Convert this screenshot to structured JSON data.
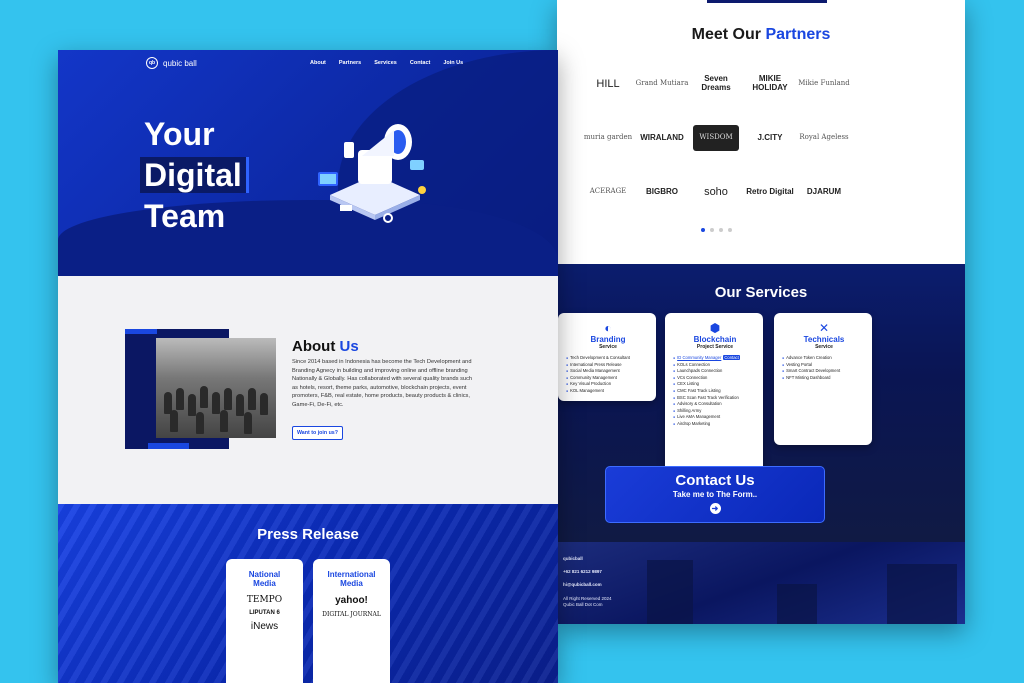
{
  "partners": {
    "title_prefix": "Meet Our",
    "title_accent": "Partners",
    "logos": [
      "HILL",
      "Grand Mutiara",
      "Seven Dreams",
      "MIKIE HOLIDAY",
      "Mikie Funland",
      "muria garden",
      "WIRALAND",
      "WISDOM",
      "J.CITY",
      "Royal Ageless",
      "ACERAGE",
      "BIGBRO",
      "soho",
      "Retro Digital",
      "DJARUM"
    ]
  },
  "services": {
    "title": "Our Services",
    "cards": [
      {
        "name": "Branding",
        "sub": "Service",
        "items": [
          "Tech Development & Consultant",
          "International Press Release",
          "Social Media Management",
          "Community Management",
          "Key Visual Production",
          "KOL Management"
        ]
      },
      {
        "name": "Blockchain",
        "sub": "Project Service",
        "items": [
          "ID Community Manager",
          "KOLs Connection",
          "Launchpads Connection",
          "VCs Connection",
          "CEX Listing",
          "CMC Fast Track Listing",
          "BSC Scan Fast Track Verification",
          "Advisory & Consultation",
          "Shilling Army",
          "Live AMA Management",
          "Airdrop Marketing"
        ],
        "tag": "Contact"
      },
      {
        "name": "Technicals",
        "sub": "Service",
        "items": [
          "Advance Token Creation",
          "Vesting Portal",
          "Smart Contract Development",
          "NFT Minting Dashboard"
        ]
      }
    ]
  },
  "contact": {
    "title": "Contact Us",
    "sub": "Take me to The Form..",
    "arrow": "➜"
  },
  "footer": {
    "name": "qubicball",
    "phone": "+62 821 6212 9897",
    "email": "hi@qubicball.com",
    "copyright1": "All Right Reserved 2024",
    "copyright2": "Qubic Ball Dot Com"
  },
  "brand": {
    "name": "qubic ball",
    "mark": "qb"
  },
  "nav": [
    "About",
    "Partners",
    "Services",
    "Contact",
    "Join Us"
  ],
  "hero": {
    "line1": "Your",
    "line2": "Digital",
    "line3": "Team"
  },
  "about": {
    "title_prefix": "About",
    "title_accent": "Us",
    "text": "Since 2014 based in Indonesia has become the Tech Development and Branding Agnecy in building and improving online and offline branding Nationally & Globally. Has collaborated with several quality brands such as hotels, resort, theme parks, automotive, blockchain projects, event promoters, F&B, real estate, home products, beauty products & clinics, Game-Fi, De-Fi, etc.",
    "button": "Want to join us?"
  },
  "press": {
    "title": "Press Release",
    "national": {
      "title1": "National",
      "title2": "Media",
      "logos": [
        "TEMPO",
        "LIPUTAN 6",
        "iNews"
      ]
    },
    "international": {
      "title1": "International",
      "title2": "Media",
      "logos": [
        "yahoo!",
        "DIGITAL JOURNAL"
      ]
    }
  },
  "colors": {
    "accent": "#1a47e0",
    "background": "#34c3ee",
    "navy": "#0a1f86"
  }
}
